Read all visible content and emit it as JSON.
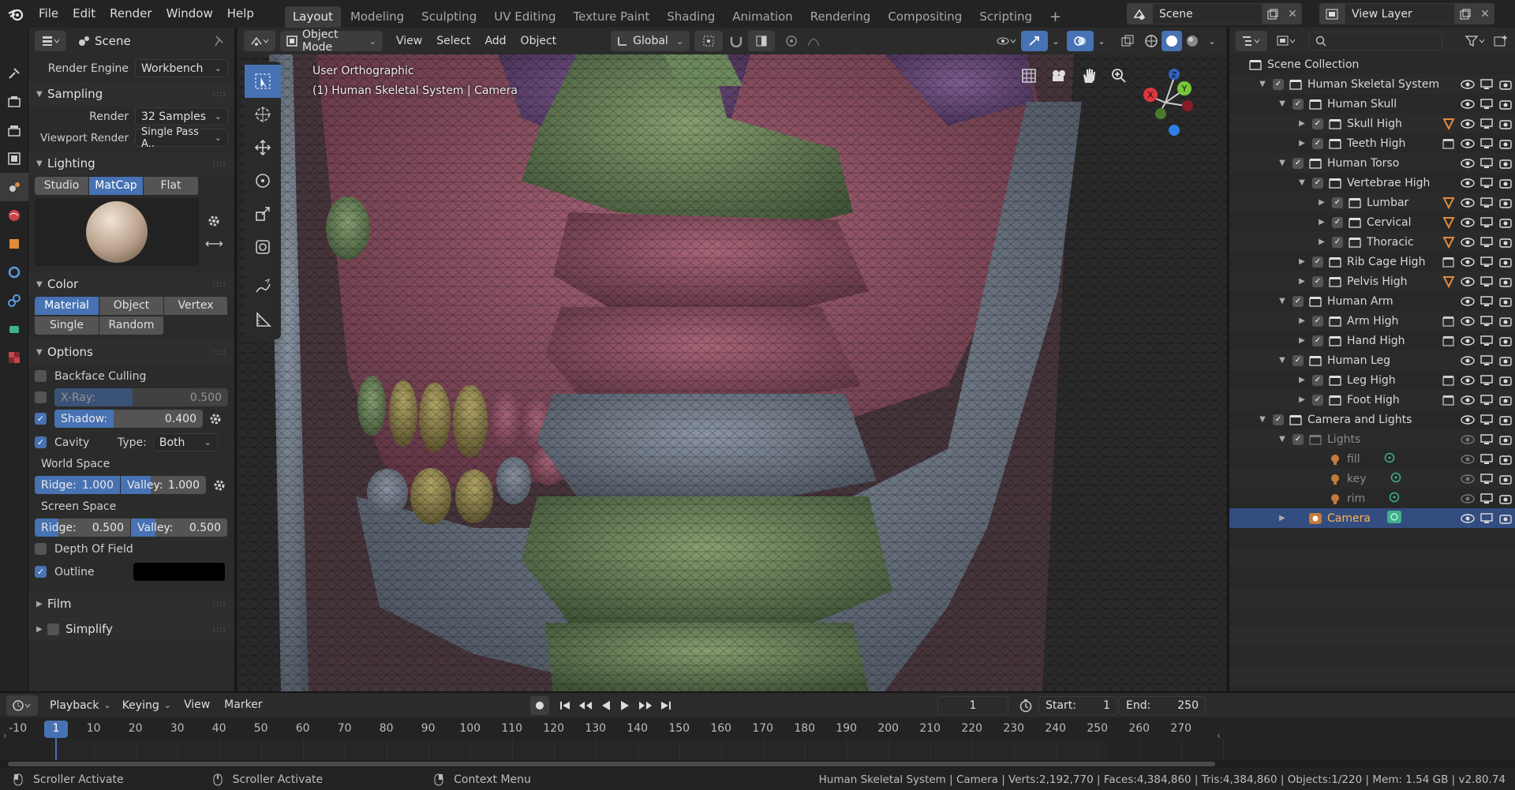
{
  "menubar": {
    "items": [
      "File",
      "Edit",
      "Render",
      "Window",
      "Help"
    ]
  },
  "workspaces": {
    "tabs": [
      "Layout",
      "Modeling",
      "Sculpting",
      "UV Editing",
      "Texture Paint",
      "Shading",
      "Animation",
      "Rendering",
      "Compositing",
      "Scripting"
    ],
    "active": "Layout",
    "add": "+"
  },
  "scene": {
    "label": "Scene"
  },
  "view_layer": {
    "label": "View Layer"
  },
  "properties": {
    "context": "Scene",
    "render_engine": {
      "label": "Render Engine",
      "value": "Workbench"
    },
    "sampling": {
      "title": "Sampling",
      "render_label": "Render",
      "render_value": "32 Samples",
      "viewport_label": "Viewport Render",
      "viewport_value": "Single Pass A.."
    },
    "lighting": {
      "title": "Lighting",
      "modes": [
        "Studio",
        "MatCap",
        "Flat"
      ],
      "active": "MatCap"
    },
    "color": {
      "title": "Color",
      "row1": [
        "Material",
        "Object",
        "Vertex"
      ],
      "row2": [
        "Single",
        "Random"
      ],
      "active": "Material"
    },
    "options": {
      "title": "Options",
      "backface": "Backface Culling",
      "xray": {
        "label": "X-Ray:",
        "value": "0.500",
        "fill": 0.45
      },
      "shadow": {
        "label": "Shadow:",
        "value": "0.400",
        "fill": 0.4
      },
      "cavity": "Cavity",
      "type_label": "Type:",
      "type_value": "Both",
      "world_space": "World Space",
      "ws_ridge": {
        "label": "Ridge:",
        "value": "1.000"
      },
      "ws_valley": {
        "label": "Valley:",
        "value": "1.000"
      },
      "screen_space": "Screen Space",
      "ss_ridge": {
        "label": "Ridge:",
        "value": "0.500"
      },
      "ss_valley": {
        "label": "Valley:",
        "value": "0.500"
      },
      "dof": "Depth Of Field",
      "outline": "Outline"
    },
    "film": {
      "title": "Film"
    },
    "simplify": {
      "title": "Simplify"
    }
  },
  "viewport": {
    "mode": "Object Mode",
    "menus": [
      "View",
      "Select",
      "Add",
      "Object"
    ],
    "transform": "Global",
    "info_line1": "User Orthographic",
    "info_line2": "(1) Human Skeletal System | Camera",
    "gizmo": {
      "x": "X",
      "y": "Y",
      "z": "Z"
    }
  },
  "outliner": {
    "rows": [
      {
        "name": "Scene Collection",
        "indent": 0,
        "tw": "",
        "type": "scene"
      },
      {
        "name": "Human Skeletal System",
        "indent": 1,
        "tw": "▼",
        "type": "coll"
      },
      {
        "name": "Human Skull",
        "indent": 2,
        "tw": "▼",
        "type": "coll"
      },
      {
        "name": "Skull High",
        "indent": 3,
        "tw": "▶",
        "type": "coll",
        "extra": "mesh"
      },
      {
        "name": "Teeth High",
        "indent": 3,
        "tw": "▶",
        "type": "coll",
        "extra": "coll"
      },
      {
        "name": "Human Torso",
        "indent": 2,
        "tw": "▼",
        "type": "coll"
      },
      {
        "name": "Vertebrae High",
        "indent": 3,
        "tw": "▼",
        "type": "coll"
      },
      {
        "name": "Lumbar",
        "indent": 4,
        "tw": "▶",
        "type": "coll",
        "extra": "mesh"
      },
      {
        "name": "Cervical",
        "indent": 4,
        "tw": "▶",
        "type": "coll",
        "extra": "mesh"
      },
      {
        "name": "Thoracic",
        "indent": 4,
        "tw": "▶",
        "type": "coll",
        "extra": "mesh"
      },
      {
        "name": "Rib Cage High",
        "indent": 3,
        "tw": "▶",
        "type": "coll",
        "extra": "coll"
      },
      {
        "name": "Pelvis High",
        "indent": 3,
        "tw": "▶",
        "type": "coll",
        "extra": "mesh"
      },
      {
        "name": "Human Arm",
        "indent": 2,
        "tw": "▼",
        "type": "coll"
      },
      {
        "name": "Arm High",
        "indent": 3,
        "tw": "▶",
        "type": "coll",
        "extra": "coll"
      },
      {
        "name": "Hand High",
        "indent": 3,
        "tw": "▶",
        "type": "coll",
        "extra": "coll"
      },
      {
        "name": "Human Leg",
        "indent": 2,
        "tw": "▼",
        "type": "coll"
      },
      {
        "name": "Leg High",
        "indent": 3,
        "tw": "▶",
        "type": "coll",
        "extra": "coll"
      },
      {
        "name": "Foot High",
        "indent": 3,
        "tw": "▶",
        "type": "coll",
        "extra": "coll"
      },
      {
        "name": "Camera and Lights",
        "indent": 1,
        "tw": "▼",
        "type": "coll"
      },
      {
        "name": "Lights",
        "indent": 2,
        "tw": "▼",
        "type": "coll",
        "dim": true
      },
      {
        "name": "fill",
        "indent": 3,
        "tw": "",
        "type": "light",
        "dim": true
      },
      {
        "name": "key",
        "indent": 3,
        "tw": "",
        "type": "light",
        "dim": true
      },
      {
        "name": "rim",
        "indent": 3,
        "tw": "",
        "type": "light",
        "dim": true
      },
      {
        "name": "Camera",
        "indent": 2,
        "tw": "▶",
        "type": "camera",
        "selected": true
      }
    ]
  },
  "timeline": {
    "menus": [
      "Playback",
      "Keying",
      "View",
      "Marker"
    ],
    "current_frame": "1",
    "start_label": "Start:",
    "start": "1",
    "end_label": "End:",
    "end": "250",
    "ticks": [
      "-10",
      "1",
      "10",
      "20",
      "30",
      "40",
      "50",
      "60",
      "70",
      "80",
      "90",
      "100",
      "110",
      "120",
      "130",
      "140",
      "150",
      "160",
      "170",
      "180",
      "190",
      "200",
      "210",
      "220",
      "230",
      "240",
      "250",
      "260",
      "270"
    ]
  },
  "statusbar": {
    "hint1": "Scroller Activate",
    "hint2": "Scroller Activate",
    "hint3": "Context Menu",
    "stats": "Human Skeletal System | Camera | Verts:2,192,770 | Faces:4,384,860 | Tris:4,384,860 | Objects:1/220 | Mem: 1.54 GB | v2.80.74"
  },
  "colors": {
    "accent": "#4772b3",
    "selected_text": "#ffb347",
    "bone_green": "#6d8a5c",
    "bone_pink": "#9a5a6c",
    "bone_purple": "#6a4d7a",
    "bone_grey": "#6e7886"
  }
}
